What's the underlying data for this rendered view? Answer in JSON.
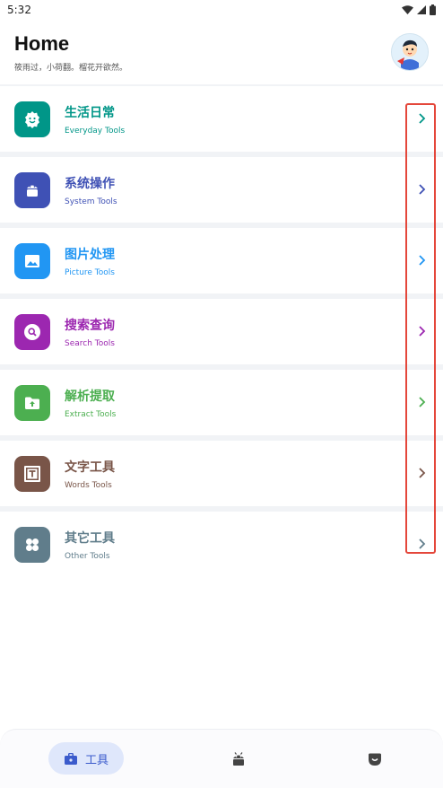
{
  "status_bar": {
    "time": "5:32"
  },
  "header": {
    "title": "Home",
    "subtitle": "筱雨过，小荷翻。榴花开欲然。"
  },
  "categories": [
    {
      "label": "生活日常",
      "sub": "Everyday Tools",
      "color": "#009688",
      "icon": "face-icon"
    },
    {
      "label": "系统操作",
      "sub": "System Tools",
      "color": "#3f51b5",
      "icon": "android-icon"
    },
    {
      "label": "图片处理",
      "sub": "Picture Tools",
      "color": "#2196f3",
      "icon": "image-icon"
    },
    {
      "label": "搜索查询",
      "sub": "Search Tools",
      "color": "#9c27b0",
      "icon": "search-icon"
    },
    {
      "label": "解析提取",
      "sub": "Extract Tools",
      "color": "#4caf50",
      "icon": "folder-upload-icon"
    },
    {
      "label": "文字工具",
      "sub": "Words Tools",
      "color": "#795548",
      "icon": "text-icon"
    },
    {
      "label": "其它工具",
      "sub": "Other Tools",
      "color": "#607d8b",
      "icon": "grid-icon"
    }
  ],
  "bottom_nav": {
    "tools_label": "工具",
    "accent": "#3b5bcc"
  }
}
